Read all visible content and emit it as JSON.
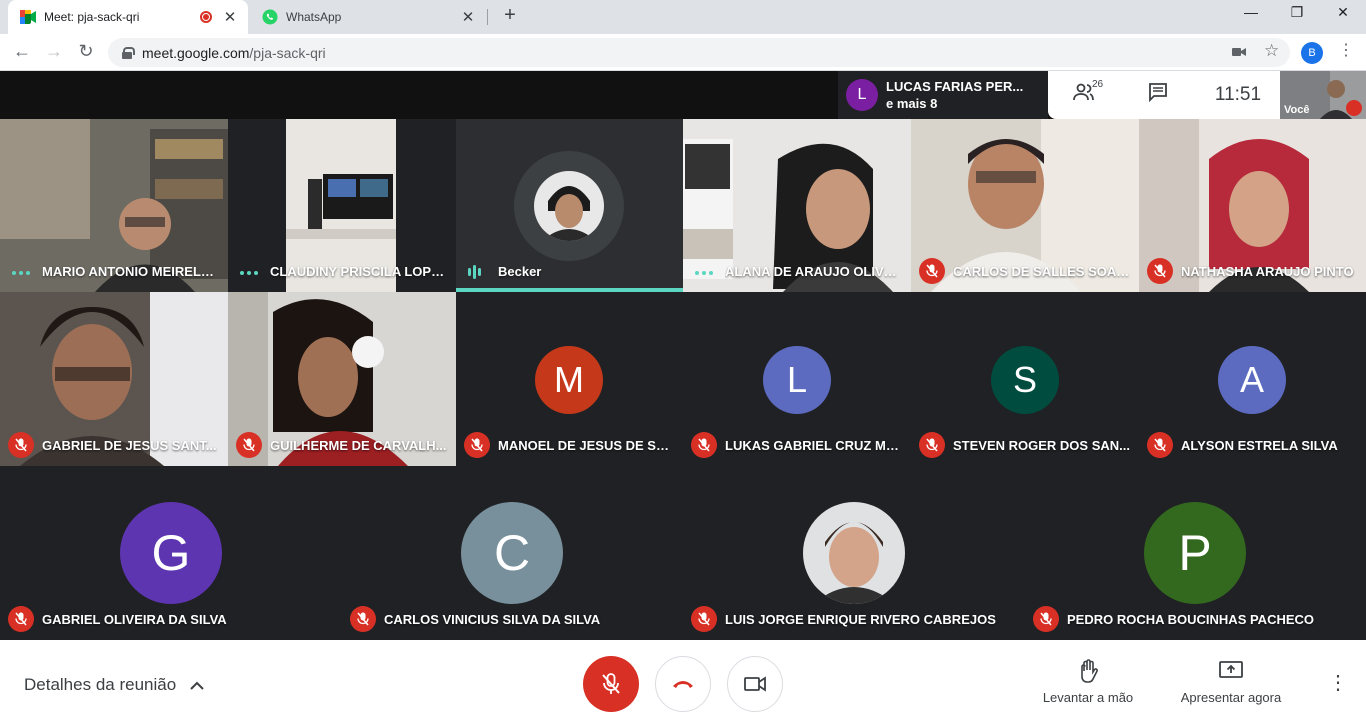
{
  "browser": {
    "tabs": [
      {
        "title": "Meet: pja-sack-qri",
        "active": true
      },
      {
        "title": "WhatsApp",
        "active": false
      }
    ],
    "url_host": "meet.google.com",
    "url_path": "/pja-sack-qri",
    "profile_initial": "B"
  },
  "meet_top": {
    "presenter_initial": "L",
    "presenter_name": "LUCAS FARIAS PER...",
    "presenter_more": "e mais 8",
    "people_count": "26",
    "clock": "11:51",
    "self_label": "Você"
  },
  "tiles": [
    {
      "name": "MARIO ANTONIO MEIRELE...",
      "indicator": "dots"
    },
    {
      "name": "CLAUDINY PRISCILA LOPE...",
      "indicator": "dots"
    },
    {
      "name": "Becker",
      "indicator": "bars"
    },
    {
      "name": "ALANA DE ARAUJO OLIVEI...",
      "indicator": "dots"
    },
    {
      "name": "CARLOS DE SALLES SOAR...",
      "indicator": "muted"
    },
    {
      "name": "NATHASHA ARAUJO PINTO",
      "indicator": "muted"
    },
    {
      "name": "GABRIEL DE JESUS SANT...",
      "indicator": "muted"
    },
    {
      "name": "GUILHERME DE CARVALH...",
      "indicator": "muted"
    },
    {
      "name": "MANOEL DE JESUS DE SO...",
      "indicator": "muted",
      "letter": "M",
      "color": "#c5391a"
    },
    {
      "name": "LUKAS GABRIEL CRUZ MO...",
      "indicator": "muted",
      "letter": "L",
      "color": "#5c6bc0"
    },
    {
      "name": "STEVEN ROGER DOS SAN...",
      "indicator": "muted",
      "letter": "S",
      "color": "#004d40"
    },
    {
      "name": "ALYSON ESTRELA SILVA",
      "indicator": "muted",
      "letter": "A",
      "color": "#5c6bc0"
    },
    {
      "name": "GABRIEL OLIVEIRA DA SILVA",
      "indicator": "muted",
      "letter": "G",
      "color": "#5e35b1"
    },
    {
      "name": "CARLOS VINICIUS SILVA DA SILVA",
      "indicator": "muted",
      "letter": "C",
      "color": "#78909c"
    },
    {
      "name": "LUIS JORGE ENRIQUE RIVERO CABREJOS",
      "indicator": "muted"
    },
    {
      "name": "PEDRO ROCHA BOUCINHAS PACHECO",
      "indicator": "muted",
      "letter": "P",
      "color": "#33691e"
    }
  ],
  "bottom": {
    "details_label": "Detalhes da reunião",
    "raise_hand_label": "Levantar a mão",
    "present_label": "Apresentar agora"
  },
  "colors": {
    "accent_teal": "#5bd6c0",
    "mute_red": "#d93025",
    "meet_dark": "#202124"
  }
}
